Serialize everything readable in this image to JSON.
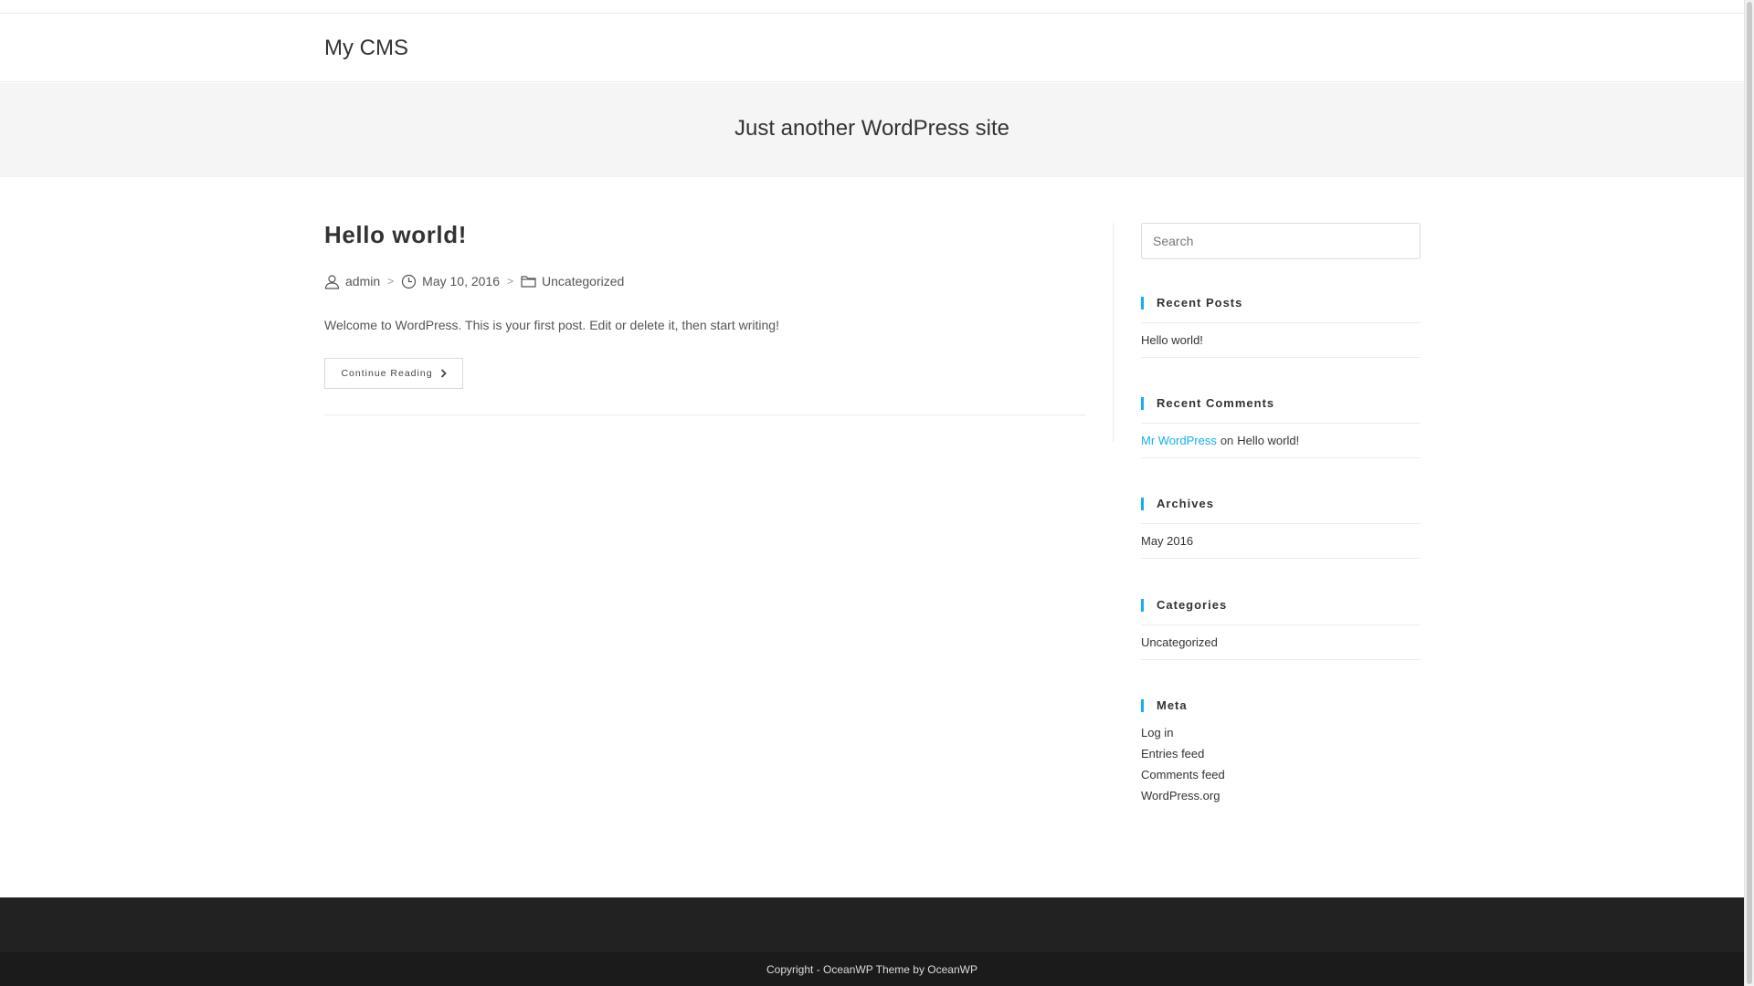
{
  "site": {
    "title": "My CMS",
    "tagline": "Just another WordPress site"
  },
  "post": {
    "title": "Hello world!",
    "author": "admin",
    "date": "May 10, 2016",
    "category": "Uncategorized",
    "excerpt": "Welcome to WordPress. This is your first post. Edit or delete it, then start writing!",
    "continue_label": "Continue Reading"
  },
  "sidebar": {
    "search_placeholder": "Search",
    "recent_posts": {
      "title": "Recent Posts",
      "items": [
        "Hello world!"
      ]
    },
    "recent_comments": {
      "title": "Recent Comments",
      "author": "Mr WordPress",
      "on": "on",
      "post": "Hello world!"
    },
    "archives": {
      "title": "Archives",
      "items": [
        "May 2016"
      ]
    },
    "categories": {
      "title": "Categories",
      "items": [
        "Uncategorized"
      ]
    },
    "meta": {
      "title": "Meta",
      "items": [
        "Log in",
        "Entries feed",
        "Comments feed",
        "WordPress.org"
      ]
    }
  },
  "footer": {
    "copyright": "Copyright - OceanWP Theme by OceanWP"
  },
  "colors": {
    "accent": "#13aff0",
    "footer_bg": "#222222",
    "page_header_bg": "#f5f5f5"
  },
  "icons": {
    "author": "user-icon",
    "date": "clock-icon",
    "category": "folder-icon",
    "continue": "chevron-right-icon"
  }
}
